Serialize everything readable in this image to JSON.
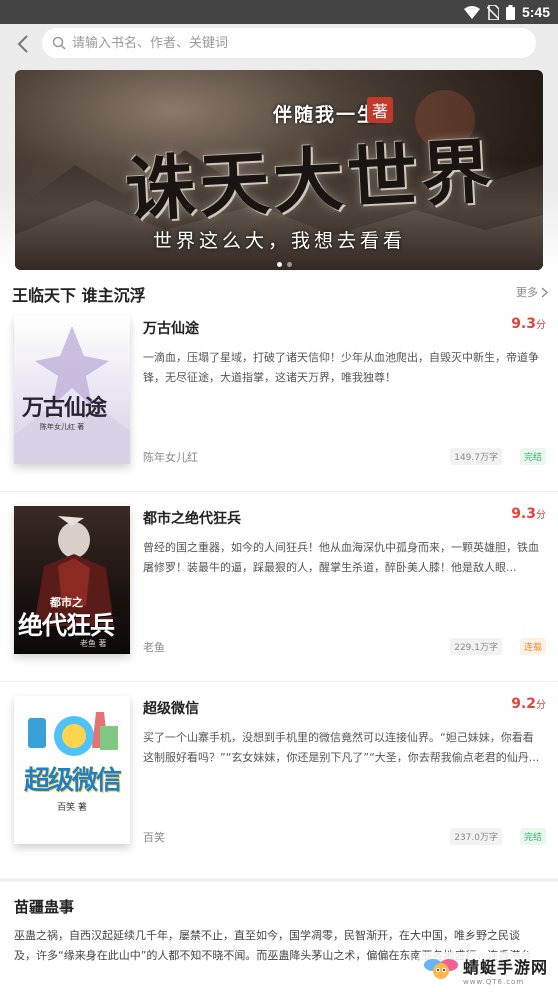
{
  "status_bar": {
    "time": "5:45"
  },
  "search": {
    "placeholder": "请输入书名、作者、关键词"
  },
  "banner": {
    "subtitle": "伴随我一生",
    "seal": "著",
    "title": "诛天大世界",
    "slogan": "世界这么大，我想去看看"
  },
  "section": {
    "title": "王临天下 谁主沉浮",
    "more_label": "更多"
  },
  "books": [
    {
      "title": "万古仙途",
      "score": "9.3",
      "score_unit": "分",
      "desc": "一滴血，压塌了星域，打破了诸天信仰！少年从血池爬出，自毁灭中新生，帝道争锋，无尽征途，大道指掌，这诸天万界，唯我独尊！",
      "author": "陈年女儿红",
      "words": "149.7万字",
      "status": "完结",
      "cover_title": "万古仙途",
      "cover_author": "陈年女儿红 著"
    },
    {
      "title": "都市之绝代狂兵",
      "score": "9.3",
      "score_unit": "分",
      "desc": "曾经的国之重器，如今的人间狂兵！他从血海深仇中孤身而来，一颗英雄胆，铁血屠修罗！装最牛的逼，踩最狠的人，醒掌生杀道，醉卧美人膝！他是敌人眼...",
      "author": "老鱼",
      "words": "229.1万字",
      "status": "连载",
      "cover_title_small": "都市之",
      "cover_title": "绝代狂兵",
      "cover_author": "老鱼 著"
    },
    {
      "title": "超级微信",
      "score": "9.2",
      "score_unit": "分",
      "desc": "买了一个山寨手机，没想到手机里的微信竟然可以连接仙界。“妲己妹妹，你看看这制服好看吗？”“玄女妹妹，你还是别下凡了”“大圣，你去帮我偷点老君的仙丹...",
      "author": "百笑",
      "words": "237.0万字",
      "status": "完结",
      "cover_title": "超级微信",
      "cover_author": "百笑 著"
    }
  ],
  "recommend": {
    "title": "苗疆蛊事",
    "desc": "巫蛊之祸，自西汉起延续几千年，屡禁不止，直至如今，国学凋零，民智渐开，在大中国，唯乡野之民谈及，许多“缘来身在此山中”的人都不知不晓不闻。而巫蛊降头茅山之术，偏偏在东南亚各地盛行，连香港台湾之地，也繁荣昌盛，流派纷起。 诸位好友，真的认为华夏大地无奇人焉？然..."
  },
  "watermark": {
    "name": "蜻蜓手游网",
    "url": "www.QT6.com"
  },
  "colors": {
    "accent": "#e8403a",
    "done": "#3ab36e",
    "serial": "#e88b3a"
  }
}
